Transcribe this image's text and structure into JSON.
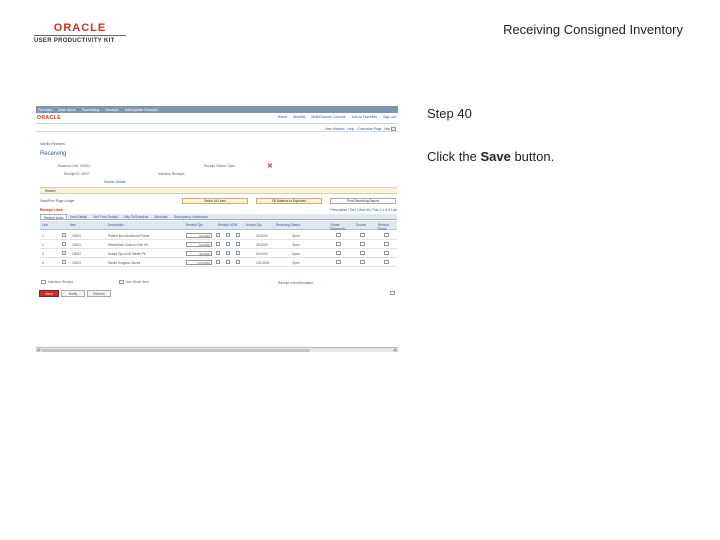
{
  "brand": {
    "oracle": "ORACLE",
    "product": "USER PRODUCTIVITY KIT"
  },
  "doc_title": "Receiving Consigned Inventory",
  "step_label": "Step 40",
  "instruction": {
    "prefix": "Click the ",
    "target": "Save",
    "suffix": " button."
  },
  "colors": {
    "oracle_red": "#d22b1f",
    "nav_bg": "#7f95b2",
    "link_blue": "#3a5c8c",
    "save_red": "#c9302c"
  },
  "screenshot": {
    "topnav": [
      "Favorites",
      "Main Menu",
      "Purchasing",
      "Receipts",
      "Add/Update Receipts"
    ],
    "oracle": "ORACLE",
    "toplinks": [
      "Home",
      "Worklist",
      "MultiChannel Console",
      "Add to Favorites",
      "Sign out"
    ],
    "sublinks": [
      "New Window",
      "Help",
      "Customize Page",
      "http"
    ],
    "breadcrumb": "Vanilla Receipts",
    "page_title": "Receiving",
    "fields": {
      "business_unit": "Business Unit: US001",
      "receipt_status": "Receipt Status: Open",
      "receipt_id": "Receipt ID: NEXT",
      "interface": "Interface Receipts",
      "header_details": "Header Details",
      "header": "Header"
    },
    "buttons": {
      "select_all": "Select All Lines",
      "fill_balance": "Fill Balance to Expected",
      "print": "Print Receiving Report"
    },
    "view_label": "View/Print Page Ledger",
    "grid_title": "Receipt Lines",
    "grid_nav": "Personalize | Find | View All | First 1-4 of 4 Last",
    "tabs": [
      "Receipt Lines",
      "Item Details",
      "Unit Price Details",
      "Ship To/Schedule",
      "Attributes",
      "Discrepancy Information"
    ],
    "columns": [
      "Line",
      "Item",
      "Description",
      "Receipt Qty",
      "Receipt UOM",
      "Accept Qty",
      "Receiving Status",
      "Create Shipments",
      "Source",
      "Receipt Errors"
    ],
    "rows": [
      {
        "line": "1",
        "item": "10000",
        "desc": "Patient Bed Aluminum Frame",
        "qty": "25.0000",
        "accept": "25.0000",
        "status": "Open"
      },
      {
        "line": "2",
        "item": "10001",
        "desc": "Wheelchair Cushion Pad Kit",
        "qty": "50.0000",
        "accept": "25.0000",
        "status": "Open"
      },
      {
        "line": "3",
        "item": "10002",
        "desc": "Suture Spool Kit Sterile Pk",
        "qty": "40.0000",
        "accept": "50.0000",
        "status": "Open"
      },
      {
        "line": "4",
        "item": "10003",
        "desc": "Sterile Surgical Gloves",
        "qty": "100.0000",
        "accept": "100.0000",
        "status": "Open"
      }
    ],
    "options": {
      "interface": "Interface Receipt",
      "non_stock": "Non Stock Item",
      "receipt_info": "Receipt Info Information"
    },
    "bottom_buttons": {
      "save": "Save",
      "notify": "Notify",
      "refresh": "Refresh"
    }
  }
}
